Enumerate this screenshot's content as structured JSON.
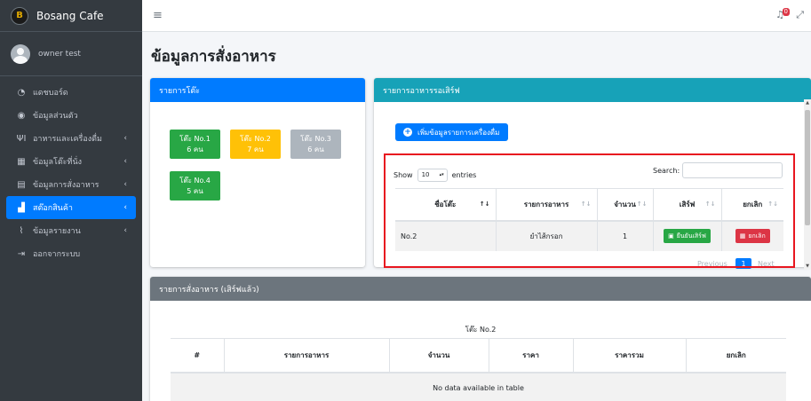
{
  "brand": {
    "name": "Bosang Cafe",
    "logo_letter": "B"
  },
  "user": {
    "name": "owner test"
  },
  "sidebar": {
    "items": [
      {
        "label": "แดชบอร์ด",
        "icon": "dashboard-icon",
        "glyph": "◔",
        "arrow": ""
      },
      {
        "label": "ข้อมูลส่วนตัว",
        "icon": "user-circle-icon",
        "glyph": "◉",
        "arrow": ""
      },
      {
        "label": "อาหารและเครื่องดื่ม",
        "icon": "utensils-icon",
        "glyph": "ΨΙ",
        "arrow": "‹"
      },
      {
        "label": "ข้อมูลโต๊ะที่นั่ง",
        "icon": "table-icon",
        "glyph": "▦",
        "arrow": "‹"
      },
      {
        "label": "ข้อมูลการสั่งอาหาร",
        "icon": "clipboard-icon",
        "glyph": "▤",
        "arrow": "‹"
      },
      {
        "label": "สต๊อกสินค้า",
        "icon": "boxes-icon",
        "glyph": "▟",
        "arrow": "‹"
      },
      {
        "label": "ข้อมูลรายงาน",
        "icon": "chart-line-icon",
        "glyph": "⌇",
        "arrow": "‹"
      },
      {
        "label": "ออกจากระบบ",
        "icon": "sign-out-icon",
        "glyph": "⇥",
        "arrow": ""
      }
    ],
    "active_index": 5
  },
  "topbar": {
    "menu_glyph": "≡",
    "bell_glyph": "♫",
    "notif_count": "0",
    "expand_glyph": "⤢"
  },
  "page": {
    "title": "ข้อมูลการสั่งอาหาร"
  },
  "tables_card": {
    "header": "รายการโต๊ะ",
    "tables": [
      {
        "name": "โต๊ะ No.1",
        "people": "6 คน",
        "status": "green"
      },
      {
        "name": "โต๊ะ No.2",
        "people": "7 คน",
        "status": "yellow"
      },
      {
        "name": "โต๊ะ No.3",
        "people": "6 คน",
        "status": "gray"
      },
      {
        "name": "โต๊ะ No.4",
        "people": "5 คน",
        "status": "green"
      }
    ]
  },
  "pending_card": {
    "header": "รายการอาหารรอเสิร์ฟ",
    "add_button": "เพิ่มข้อมูลรายการเครื่องดื่ม",
    "show_label": "Show",
    "entries_value": "10",
    "entries_label": "entries",
    "search_label": "Search:",
    "columns": [
      "ชื่อโต๊ะ",
      "รายการอาหาร",
      "จำนวน",
      "เสิร์ฟ",
      "ยกเลิก"
    ],
    "rows": [
      {
        "table": "No.2",
        "food": "ยำไส้กรอก",
        "qty": "1",
        "serve_label": "ยืนยันเสิร์ฟ",
        "cancel_label": "ยกเลิก"
      }
    ],
    "pager": {
      "previous": "Previous",
      "page": "1",
      "next": "Next"
    }
  },
  "served_card": {
    "header": "รายการสั่งอาหาร (เสิร์ฟแล้ว)",
    "subtitle": "โต๊ะ No.2",
    "columns": [
      "#",
      "รายการอาหาร",
      "จำนวน",
      "ราคา",
      "ราคารวม",
      "ยกเลิก"
    ],
    "empty_message": "No data available in table"
  },
  "colors": {
    "sidebar_bg": "#343a40",
    "primary": "#007bff",
    "info": "#17a2b8",
    "success": "#28a745",
    "warning": "#ffc107",
    "danger": "#dc3545",
    "secondary": "#6c757d",
    "highlight_box": "#e8161f"
  }
}
